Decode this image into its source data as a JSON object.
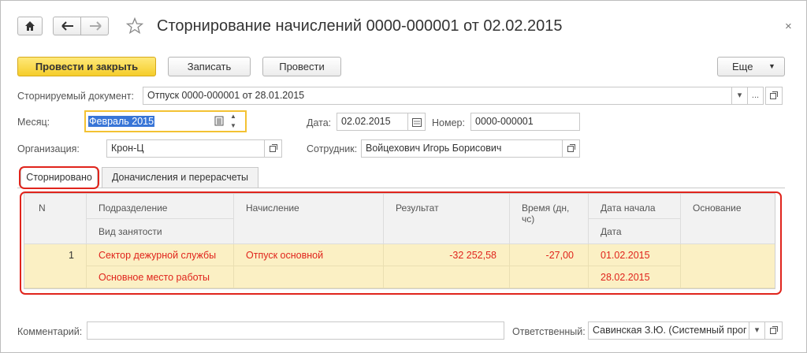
{
  "window": {
    "title": "Сторнирование начислений 0000-000001 от 02.02.2015",
    "close": "×"
  },
  "toolbar": {
    "post_close": "Провести и закрыть",
    "save": "Записать",
    "post": "Провести",
    "more": "Еще"
  },
  "form": {
    "doc_label": "Сторнируемый документ:",
    "doc_value": "Отпуск 0000-000001 от 28.01.2015",
    "month_label": "Месяц:",
    "month_value": "Февраль 2015",
    "date_label": "Дата:",
    "date_value": "02.02.2015",
    "number_label": "Номер:",
    "number_value": "0000-000001",
    "org_label": "Организация:",
    "org_value": "Крон-Ц",
    "employee_label": "Сотрудник:",
    "employee_value": "Войцехович Игорь Борисович",
    "comment_label": "Комментарий:",
    "comment_value": "",
    "responsible_label": "Ответственный:",
    "responsible_value": "Савинская З.Ю. (Системный прог"
  },
  "tabs": [
    {
      "label": "Сторнировано",
      "active": true
    },
    {
      "label": "Доначисления и перерасчеты",
      "active": false
    }
  ],
  "table": {
    "headers": {
      "n": "N",
      "department": "Подразделение",
      "employment": "Вид занятости",
      "accrual": "Начисление",
      "result": "Результат",
      "time": "Время (дн, чс)",
      "start_date": "Дата начала",
      "date": "Дата",
      "basis": "Основание"
    },
    "rows": [
      {
        "n": "1",
        "department": "Сектор дежурной службы",
        "employment": "Основное место работы",
        "accrual": "Отпуск основной",
        "result": "-32 252,58",
        "time": "-27,00",
        "start_date": "01.02.2015",
        "date": "28.02.2015",
        "basis": ""
      }
    ]
  },
  "colors": {
    "accent": "#f5cd2a",
    "highlight_row": "#fbf0c4",
    "storno_text": "#e0241c",
    "annotation": "#e0241c"
  }
}
